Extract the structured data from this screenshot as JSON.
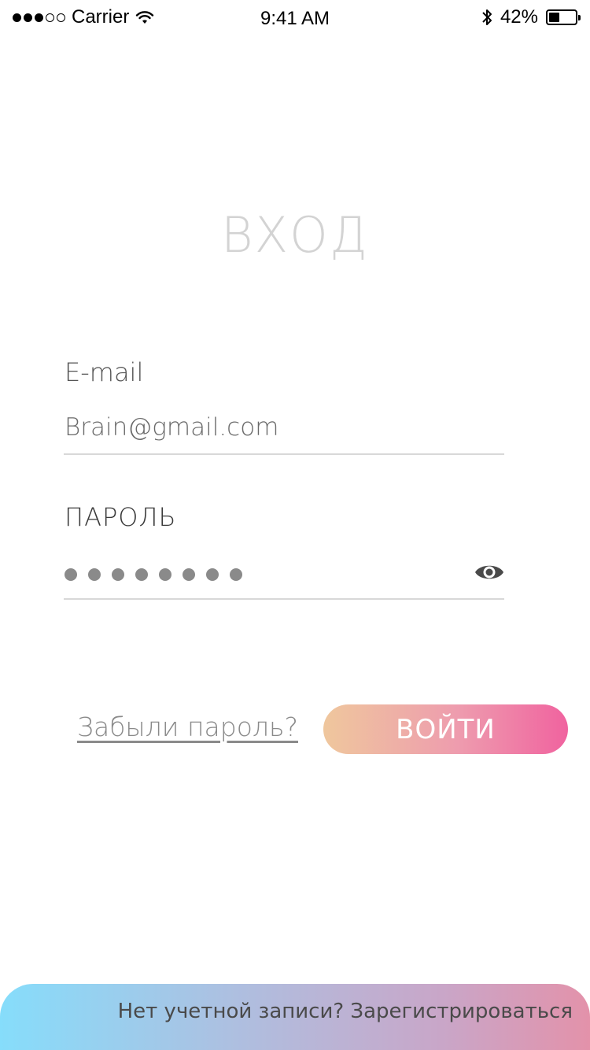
{
  "status_bar": {
    "carrier": "Carrier",
    "time": "9:41 AM",
    "battery_percent": "42%",
    "battery_level": 0.42,
    "signal_bars_filled": 3,
    "signal_bars_total": 5
  },
  "title": "ВХОД",
  "email": {
    "label": "E-mail",
    "value": "Brain@gmail.com"
  },
  "password": {
    "label": "ПАРОЛЬ",
    "masked_length": 8,
    "toggle_icon": "eye-icon"
  },
  "actions": {
    "forgot_label": "Забыли пароль?",
    "login_label": "ВОЙТИ"
  },
  "register": {
    "text": "Нет учетной записи? Зарегистрироваться"
  },
  "colors": {
    "login_gradient": [
      "#efc79d",
      "#ee9cae",
      "#f0639f"
    ],
    "register_gradient": [
      "#86ddfb",
      "#aebfe0",
      "#c9a6c8",
      "#e392aa"
    ],
    "title": "#d3d3d3"
  }
}
